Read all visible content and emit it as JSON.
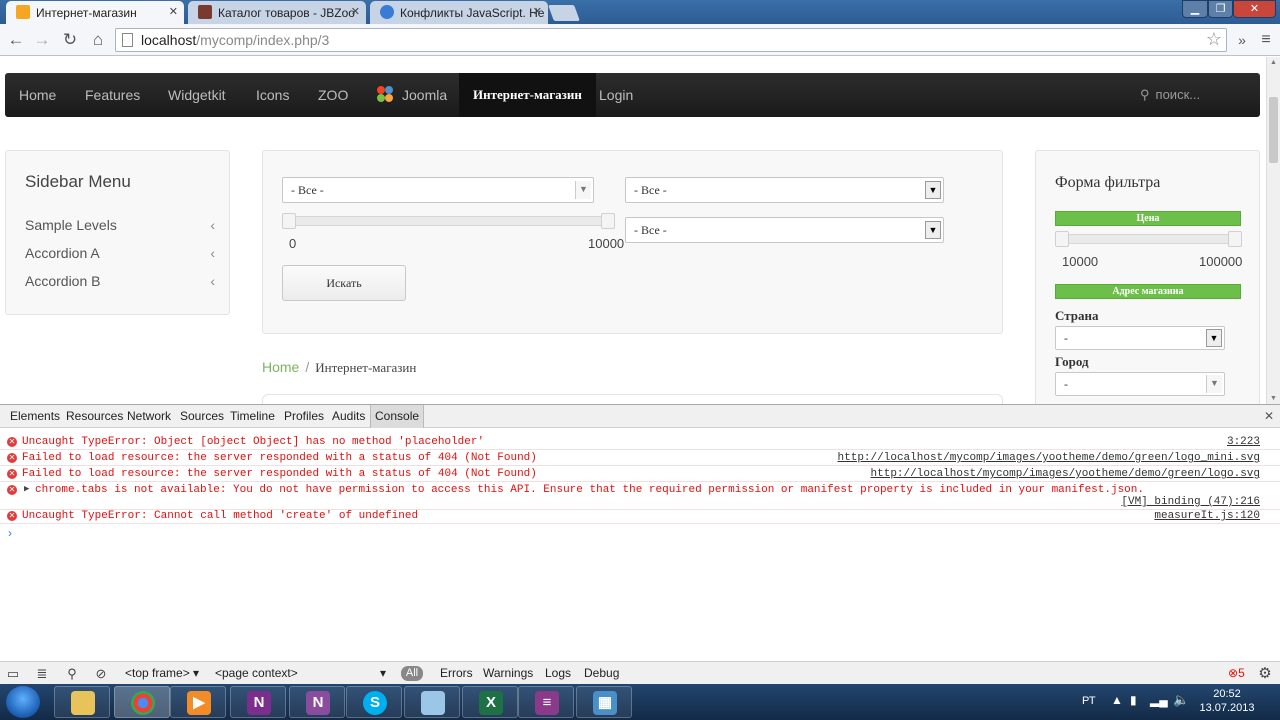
{
  "browser": {
    "tabs": [
      {
        "title": "Интернет-магазин",
        "active": true
      },
      {
        "title": "Каталог товаров - JBZoo",
        "active": false
      },
      {
        "title": "Конфликты JavaScript. Не",
        "active": false
      }
    ],
    "url_host": "localhost",
    "url_path": "/mycomp/index.php/3",
    "minimize": "▁",
    "maximize": "❐",
    "close": "✕"
  },
  "site": {
    "nav": {
      "items": [
        "Home",
        "Features",
        "Widgetkit",
        "Icons",
        "ZOO",
        "Joomla",
        "Интернет-магазин",
        "Login"
      ],
      "search_placeholder": "поиск..."
    },
    "sidebar": {
      "title": "Sidebar Menu",
      "items": [
        "Sample Levels",
        "Accordion A",
        "Accordion B"
      ]
    },
    "filter": {
      "select1": "- Все -",
      "select2": "- Все -",
      "select3": "- Все -",
      "range_min": "0",
      "range_max": "10000",
      "search_button": "Искать"
    },
    "breadcrumb": {
      "home": "Home",
      "separator": "/",
      "current": "Интернет-магазин"
    },
    "right_filter": {
      "title": "Форма фильтра",
      "price_header": "Цена",
      "price_min": "10000",
      "price_max": "100000",
      "address_header": "Адрес магазина",
      "country_label": "Страна",
      "country_value": "-",
      "city_label": "Город",
      "city_value": "-"
    }
  },
  "devtools": {
    "tabs": [
      "Elements",
      "Resources",
      "Network",
      "Sources",
      "Timeline",
      "Profiles",
      "Audits",
      "Console"
    ],
    "active_tab": "Console",
    "messages": [
      {
        "text": "Uncaught TypeError: Object [object Object] has no method 'placeholder'",
        "source": "3:223"
      },
      {
        "text": "Failed to load resource: the server responded with a status of 404 (Not Found)",
        "source": "http://localhost/mycomp/images/yootheme/demo/green/logo_mini.svg"
      },
      {
        "text": "Failed to load resource: the server responded with a status of 404 (Not Found)",
        "source": "http://localhost/mycomp/images/yootheme/demo/green/logo.svg"
      },
      {
        "text": "chrome.tabs is not available: You do not have permission to access this API. Ensure that the required permission or manifest property is included in your manifest.json.",
        "source": "[VM] binding (47):216"
      },
      {
        "text": "Uncaught TypeError: Cannot call method 'create' of undefined",
        "source": "measureIt.js:120"
      }
    ],
    "prompt": "›",
    "bottom": {
      "frame": "<top frame>",
      "context": "<page context>",
      "filter_all": "All",
      "filters": [
        "Errors",
        "Warnings",
        "Logs",
        "Debug"
      ],
      "error_count": "5"
    }
  },
  "taskbar": {
    "language": "РТ",
    "time": "20:52",
    "date": "13.07.2013"
  },
  "colors": {
    "accent_green": "#6cbf49",
    "error_red": "#e01010",
    "nav_dark": "#1a1a1a"
  }
}
